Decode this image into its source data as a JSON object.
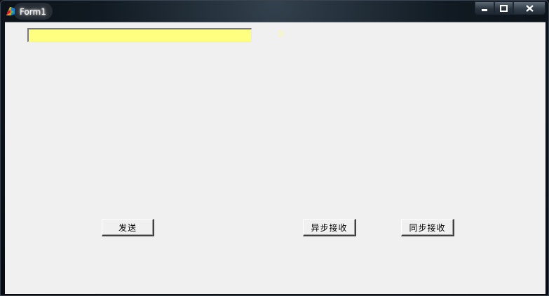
{
  "window": {
    "title": "Form1",
    "app_icon": "delphi-app-icon",
    "controls": {
      "minimize_icon": "minimize-icon",
      "maximize_icon": "maximize-icon",
      "close_icon": "close-icon"
    }
  },
  "form": {
    "edit_value": "",
    "edit_background": "#ffff80",
    "status_label": "0",
    "status_label_color": "#ffff80",
    "buttons": {
      "send": "发送",
      "async_receive": "异步接收",
      "sync_receive": "同步接收"
    }
  }
}
